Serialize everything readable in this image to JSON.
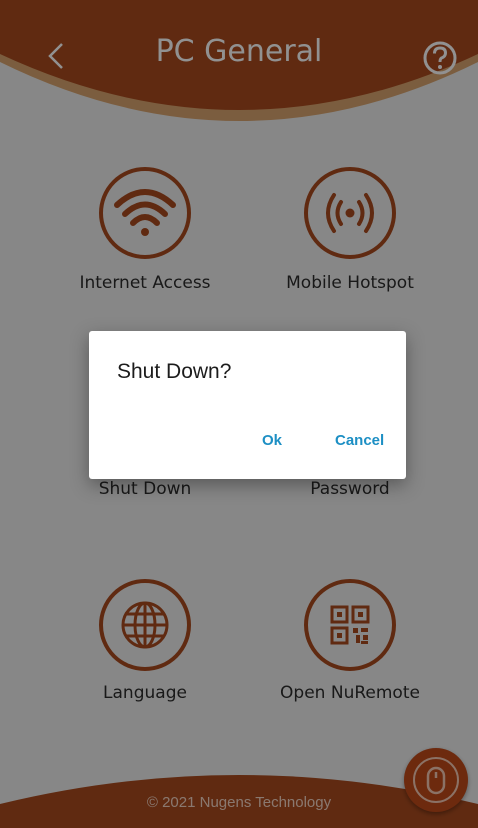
{
  "header": {
    "title": "PC General"
  },
  "grid": [
    {
      "label": "Internet Access",
      "icon": "wifi-icon"
    },
    {
      "label": "Mobile Hotspot",
      "icon": "hotspot-icon"
    },
    {
      "label": "Shut Down",
      "icon": "power-icon"
    },
    {
      "label": "Password",
      "icon": "lock-icon"
    },
    {
      "label": "Language",
      "icon": "globe-icon"
    },
    {
      "label": "Open NuRemote",
      "icon": "qr-code-icon"
    }
  ],
  "footer": {
    "text": "© 2021 Nugens Technology"
  },
  "dialog": {
    "title": "Shut Down?",
    "ok_label": "Ok",
    "cancel_label": "Cancel"
  },
  "colors": {
    "brand": "#a94b1f",
    "header": "#a94b1f",
    "accent_button": "#c04a1a",
    "dialog_action": "#1d8fc4"
  }
}
